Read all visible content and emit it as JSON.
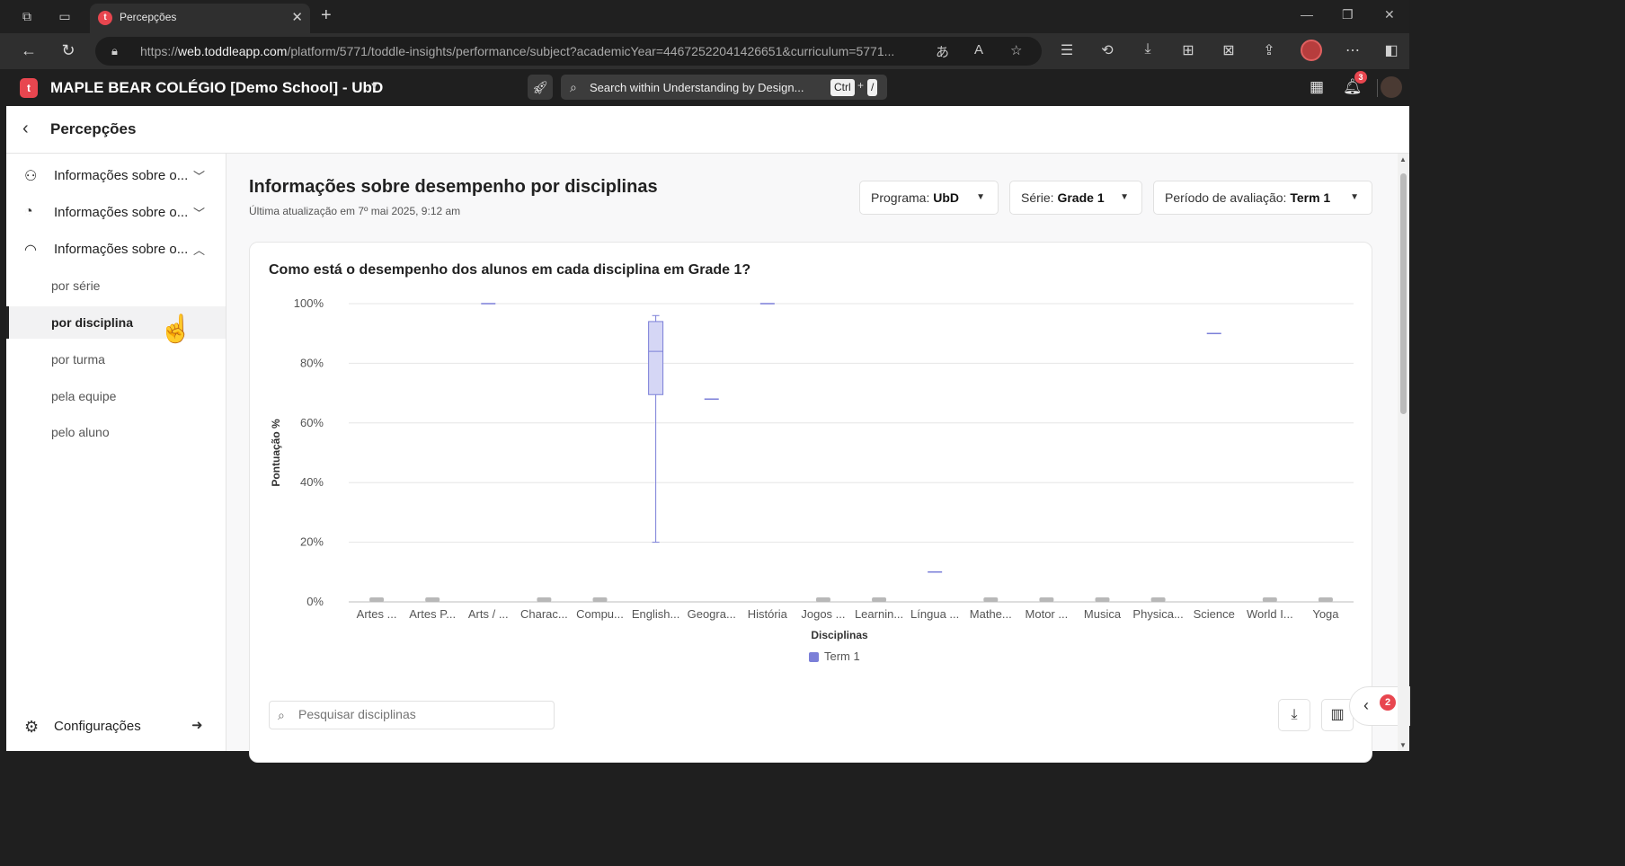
{
  "browser": {
    "tab_title": "Percepções",
    "favicon_letter": "t",
    "url_prefix": "https://",
    "url_domain": "web.toddleapp.com",
    "url_path": "/platform/5771/toddle-insights/performance/subject?academicYear=44672522041426651&curriculum=5771..."
  },
  "app": {
    "logo_letter": "t",
    "school_name": "MAPLE BEAR COLÉGIO [Demo School] - UbD",
    "search_placeholder": "Search within Understanding by Design...",
    "shortcut_key1": "Ctrl",
    "shortcut_plus": "+",
    "shortcut_key2": "/",
    "notification_count": "3"
  },
  "page": {
    "title": "Percepções"
  },
  "sidebar": {
    "items": [
      {
        "label": "Informações sobre o..."
      },
      {
        "label": "Informações sobre o..."
      },
      {
        "label": "Informações sobre o..."
      }
    ],
    "subitems": [
      {
        "label": "por série"
      },
      {
        "label": "por disciplina"
      },
      {
        "label": "por turma"
      },
      {
        "label": "pela equipe"
      },
      {
        "label": "pelo aluno"
      }
    ],
    "settings_label": "Configurações"
  },
  "main": {
    "title": "Informações sobre desempenho por disciplinas",
    "updated": "Última atualização em 7º mai 2025, 9:12 am",
    "filters": {
      "program_label": "Programa:",
      "program_value": "UbD",
      "grade_label": "Série:",
      "grade_value": "Grade 1",
      "period_label": "Período de avaliação:",
      "period_value": "Term 1"
    },
    "card_title": "Como está o desempenho dos alunos em cada disciplina em Grade 1?",
    "search_subjects_placeholder": "Pesquisar disciplinas",
    "help_badge": "2"
  },
  "chart_data": {
    "type": "boxplot",
    "xlabel": "Disciplinas",
    "ylabel": "Pontuação %",
    "ylim": [
      0,
      100
    ],
    "yticks": [
      "0%",
      "20%",
      "40%",
      "60%",
      "80%",
      "100%"
    ],
    "legend": [
      "Term 1"
    ],
    "legend_placement": "bottom",
    "series_color": "#7b7fd8",
    "empty_color": "#b8b8b8",
    "categories": [
      "Artes ...",
      "Artes P...",
      "Arts / ...",
      "Charac...",
      "Compu...",
      "English...",
      "Geogra...",
      "História",
      "Jogos ...",
      "Learnin...",
      "Língua ...",
      "Mathe...",
      "Motor ...",
      "Musica",
      "Physica...",
      "Science",
      "World I...",
      "Yoga"
    ],
    "boxes": [
      null,
      null,
      {
        "min": 100,
        "q1": 100,
        "median": 100,
        "q3": 100,
        "max": 100
      },
      null,
      null,
      {
        "min": 20,
        "q1": 69.5,
        "median": 84,
        "q3": 94,
        "max": 96
      },
      {
        "min": 68,
        "q1": 68,
        "median": 68,
        "q3": 68,
        "max": 68
      },
      {
        "min": 100,
        "q1": 100,
        "median": 100,
        "q3": 100,
        "max": 100
      },
      null,
      null,
      {
        "min": 10,
        "q1": 10,
        "median": 10,
        "q3": 10,
        "max": 10
      },
      null,
      null,
      null,
      null,
      {
        "min": 90,
        "q1": 90,
        "median": 90,
        "q3": 90,
        "max": 90
      },
      null,
      null
    ]
  }
}
